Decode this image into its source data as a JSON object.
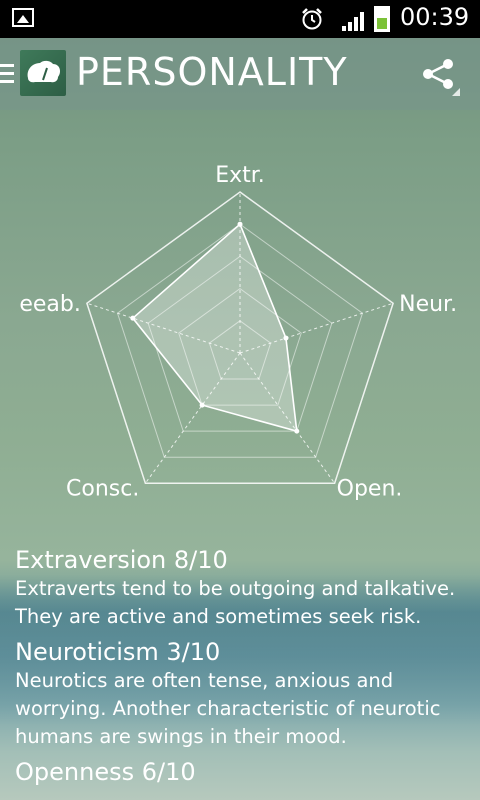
{
  "status_bar": {
    "time": "00:39"
  },
  "action_bar": {
    "title": "PERSONALITY"
  },
  "chart_data": {
    "type": "radar",
    "axes": [
      "Extr.",
      "Neur.",
      "Open.",
      "Consc.",
      "eeab."
    ],
    "values": [
      8,
      3,
      6,
      4,
      7
    ],
    "range": [
      0,
      10
    ]
  },
  "traits": [
    {
      "title": "Extraversion 8/10",
      "description": "Extraverts tend to be outgoing and talkative. They are active and sometimes seek risk."
    },
    {
      "title": "Neuroticism 3/10",
      "description": "Neurotics are often tense, anxious and worrying. Another characteristic of neurotic humans are swings in their mood."
    },
    {
      "title": "Openness 6/10",
      "description": ""
    }
  ]
}
